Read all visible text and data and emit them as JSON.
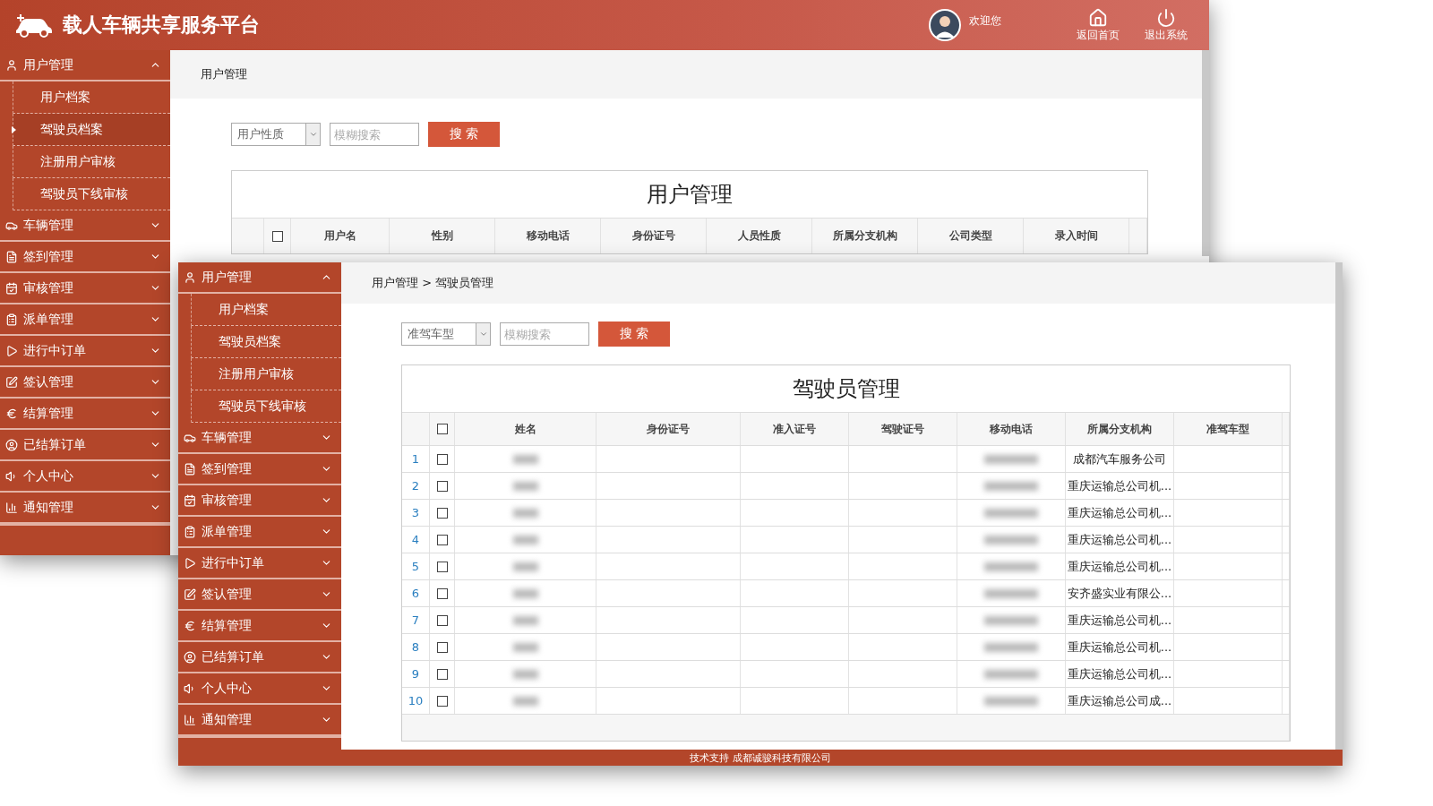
{
  "back_window": {
    "header": {
      "title": "载人车辆共享服务平台",
      "welcome": "欢迎您",
      "actions": [
        {
          "kind": "home",
          "label": "返回首页"
        },
        {
          "kind": "logout",
          "label": "退出系统"
        }
      ]
    },
    "sidebar": {
      "items": [
        {
          "label": "用户管理",
          "expanded": true,
          "children": [
            {
              "label": "用户档案",
              "selected": false
            },
            {
              "label": "驾驶员档案",
              "selected": true
            },
            {
              "label": "注册用户审核",
              "selected": false
            },
            {
              "label": "驾驶员下线审核",
              "selected": false
            }
          ]
        },
        {
          "label": "车辆管理",
          "expanded": false
        },
        {
          "label": "签到管理",
          "expanded": false
        },
        {
          "label": "审核管理",
          "expanded": false
        },
        {
          "label": "派单管理",
          "expanded": false
        },
        {
          "label": "进行中订单",
          "expanded": false
        },
        {
          "label": "签认管理",
          "expanded": false
        },
        {
          "label": "结算管理",
          "expanded": false
        },
        {
          "label": "已结算订单",
          "expanded": false
        },
        {
          "label": "个人中心",
          "expanded": false
        },
        {
          "label": "通知管理",
          "expanded": false
        }
      ]
    },
    "breadcrumb": [
      "用户管理"
    ],
    "filter": {
      "select": "用户性质",
      "placeholder": "模糊搜索",
      "button": "搜 索"
    },
    "table": {
      "title": "用户管理",
      "header_checked": false,
      "columns": [
        "用户名",
        "性别",
        "移动电话",
        "身份证号",
        "人员性质",
        "所属分支机构",
        "公司类型",
        "录入时间"
      ]
    }
  },
  "front_window": {
    "sidebar": {
      "items": [
        {
          "label": "用户管理",
          "expanded": true,
          "children": [
            {
              "label": "用户档案",
              "selected": false
            },
            {
              "label": "驾驶员档案",
              "selected": false
            },
            {
              "label": "注册用户审核",
              "selected": false
            },
            {
              "label": "驾驶员下线审核",
              "selected": false
            }
          ]
        },
        {
          "label": "车辆管理",
          "expanded": false
        },
        {
          "label": "签到管理",
          "expanded": false
        },
        {
          "label": "审核管理",
          "expanded": false
        },
        {
          "label": "派单管理",
          "expanded": false
        },
        {
          "label": "进行中订单",
          "expanded": false
        },
        {
          "label": "签认管理",
          "expanded": false
        },
        {
          "label": "结算管理",
          "expanded": false
        },
        {
          "label": "已结算订单",
          "expanded": false
        },
        {
          "label": "个人中心",
          "expanded": false
        },
        {
          "label": "通知管理",
          "expanded": false
        }
      ]
    },
    "breadcrumb": [
      "用户管理",
      "驾驶员管理"
    ],
    "breadcrumb_separator": ">",
    "filter": {
      "select": "准驾车型",
      "placeholder": "模糊搜索",
      "button": "搜 索"
    },
    "table": {
      "title": "驾驶员管理",
      "header_checked": false,
      "columns": [
        "姓名",
        "身份证号",
        "准入证号",
        "驾驶证号",
        "移动电话",
        "所属分支机构",
        "准驾车型"
      ],
      "rows": [
        {
          "index": "1",
          "checked": false,
          "branch": "成都汽车服务公司"
        },
        {
          "index": "2",
          "checked": false,
          "branch": "重庆运输总公司机..."
        },
        {
          "index": "3",
          "checked": false,
          "branch": "重庆运输总公司机..."
        },
        {
          "index": "4",
          "checked": false,
          "branch": "重庆运输总公司机..."
        },
        {
          "index": "5",
          "checked": false,
          "branch": "重庆运输总公司机..."
        },
        {
          "index": "6",
          "checked": false,
          "branch": "安齐盛实业有限公..."
        },
        {
          "index": "7",
          "checked": false,
          "branch": "重庆运输总公司机..."
        },
        {
          "index": "8",
          "checked": false,
          "branch": "重庆运输总公司机..."
        },
        {
          "index": "9",
          "checked": false,
          "branch": "重庆运输总公司机..."
        },
        {
          "index": "10",
          "checked": false,
          "branch": "重庆运输总公司成..."
        }
      ]
    },
    "footer": "技术支持 成都诚骏科技有限公司"
  }
}
